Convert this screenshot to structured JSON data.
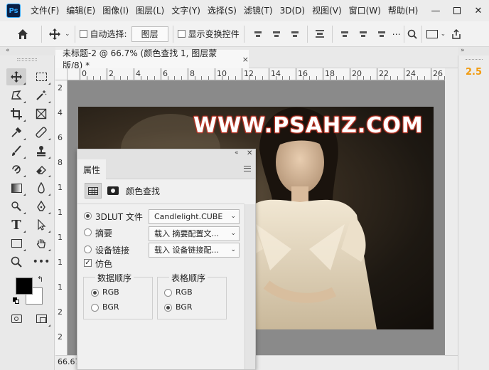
{
  "app": {
    "logo_text": "Ps",
    "menu": [
      "文件(F)",
      "编辑(E)",
      "图像(I)",
      "图层(L)",
      "文字(Y)",
      "选择(S)",
      "滤镜(T)",
      "3D(D)",
      "视图(V)",
      "窗口(W)",
      "帮助(H)"
    ],
    "window_controls": {
      "minimize": "—",
      "close": "✕"
    }
  },
  "options_bar": {
    "auto_select_label": "自动选择:",
    "auto_select_target": "图层",
    "show_transform_label": "显示变换控件"
  },
  "document": {
    "tab_title": "未标题-2 @ 66.7% (颜色查找 1, 图层蒙版/8) *",
    "close_glyph": "×",
    "ruler_h_labels": [
      "0",
      "2",
      "4",
      "6",
      "8",
      "10",
      "12",
      "14",
      "16",
      "18",
      "20",
      "22",
      "24",
      "26"
    ],
    "ruler_v_labels": [
      "2",
      "4",
      "6",
      "8",
      "1",
      "1",
      "1",
      "1",
      "1",
      "2",
      "2"
    ],
    "watermark": "WWW.PSAHZ.COM",
    "zoom_status": "66.67"
  },
  "right_panel": {
    "value": "2.5"
  },
  "properties_panel": {
    "tab_label": "属性",
    "title": "颜色查找",
    "rows": [
      {
        "label": "3DLUT 文件",
        "selected": true,
        "value": "Candlelight.CUBE"
      },
      {
        "label": "摘要",
        "selected": false,
        "value": "载入 摘要配置文..."
      },
      {
        "label": "设备链接",
        "selected": false,
        "value": "载入 设备链接配..."
      }
    ],
    "dither_label": "仿色",
    "dither_checked": true,
    "data_order": {
      "title": "数据顺序",
      "options": [
        "RGB",
        "BGR"
      ],
      "selected": "RGB"
    },
    "table_order": {
      "title": "表格顺序",
      "options": [
        "RGB",
        "BGR"
      ],
      "selected": "BGR"
    }
  },
  "colors": {
    "foreground": "#000000",
    "background": "#ffffff",
    "accent_value": "#f29b0e",
    "watermark_stroke": "#c0392b"
  }
}
